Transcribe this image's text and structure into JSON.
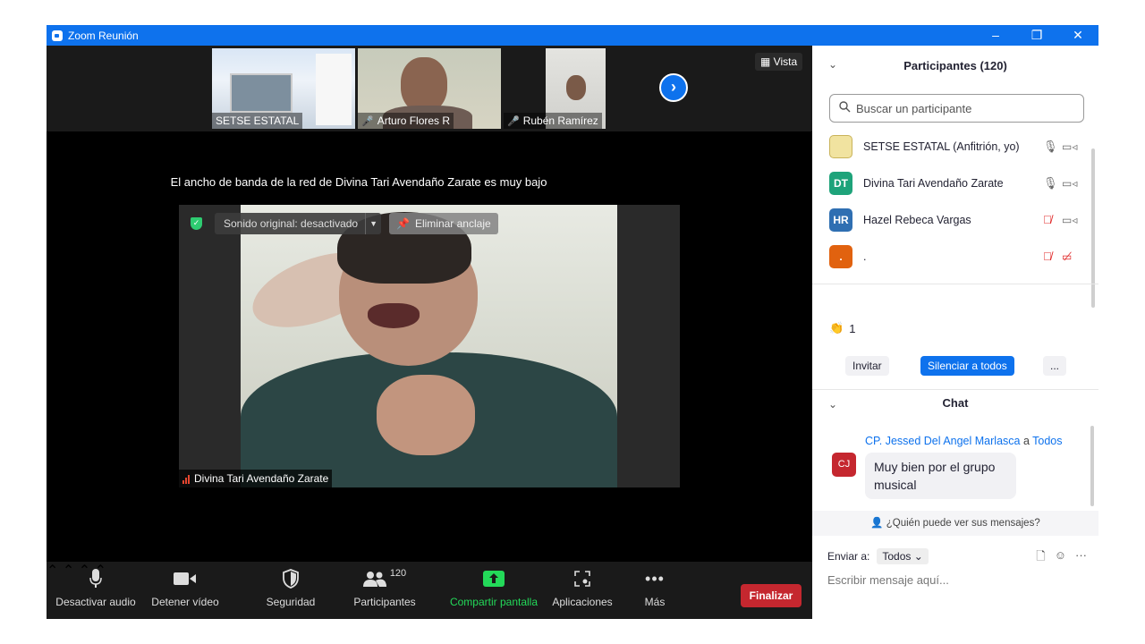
{
  "window": {
    "title": "Zoom Reunión",
    "controls": {
      "minimize": "–",
      "restore": "❐",
      "close": "✕"
    }
  },
  "strip": {
    "thumbs": [
      {
        "name": "SETSE ESTATAL",
        "muted": false
      },
      {
        "name": "Arturo Flores R",
        "muted": true
      },
      {
        "name": "Rubén Ramírez",
        "muted": true
      }
    ],
    "next_icon": "chevron-right-icon",
    "view_label": "Vista"
  },
  "main": {
    "bandwidth_message": "El ancho de banda de la red de Divina Tari Avendaño Zarate es muy bajo",
    "original_sound": "Sonido original: desactivado",
    "unpin": "Eliminar anclaje",
    "speaker_name": "Divina Tari Avendaño Zarate"
  },
  "toolbar": {
    "audio": "Desactivar audio",
    "video": "Detener vídeo",
    "security": "Seguridad",
    "participants": "Participantes",
    "participants_count": "120",
    "share": "Compartir pantalla",
    "apps": "Aplicaciones",
    "more": "Más",
    "end": "Finalizar"
  },
  "panel": {
    "participants_title": "Participantes (120)",
    "search_placeholder": "Buscar un participante",
    "participants": [
      {
        "initials": "",
        "name": "SETSE ESTATAL (Anfitrión, yo)",
        "avatar_color": "#f1e3a0",
        "mic_muted": false,
        "cam_off": false
      },
      {
        "initials": "DT",
        "name": "Divina Tari Avendaño Zarate",
        "avatar_color": "#1ea37a",
        "mic_muted": false,
        "cam_off": false
      },
      {
        "initials": "HR",
        "name": "Hazel Rebeca Vargas",
        "avatar_color": "#2f6fb2",
        "mic_muted": true,
        "cam_off": false
      },
      {
        "initials": ".",
        "name": ".",
        "avatar_color": "#e1620f",
        "mic_muted": true,
        "cam_off": true
      }
    ],
    "raise_count": "1",
    "invite": "Invitar",
    "mute_all": "Silenciar a todos",
    "more": "...",
    "chat_title": "Chat",
    "message": {
      "sender": "CP. Jessed  Del Angel Marlasca",
      "to_word": "a",
      "to": "Todos",
      "avatar": "CJ",
      "text": "Muy bien por el grupo musical"
    },
    "who_can_see": "¿Quién puede ver sus mensajes?",
    "send_to_label": "Enviar a:",
    "send_to_value": "Todos",
    "write_placeholder": "Escribir mensaje aquí..."
  },
  "colors": {
    "accent": "#0e72ed",
    "end": "#c5272f",
    "share": "#23d959",
    "muted": "#e02828"
  }
}
